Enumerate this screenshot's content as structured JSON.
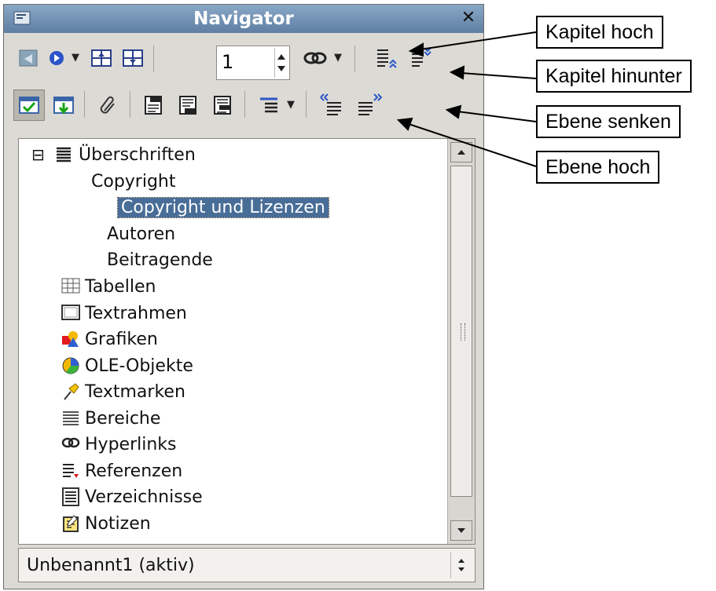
{
  "window": {
    "title": "Navigator",
    "close_glyph": "✕"
  },
  "toolbar1": {
    "spin_value": "1",
    "items": [
      {
        "icon": "toggle-icon"
      },
      {
        "icon": "navigation-icon"
      },
      {
        "icon": "previous-icon"
      },
      {
        "icon": "next-icon"
      },
      {
        "icon": "drag-mode-icon"
      },
      {
        "icon": "promote-chapter-icon"
      },
      {
        "icon": "demote-chapter-icon"
      }
    ]
  },
  "toolbar2": {
    "items": [
      {
        "icon": "content-view-icon",
        "pressed": true
      },
      {
        "icon": "set-reminder-icon"
      },
      {
        "icon": "edit-icon"
      },
      {
        "icon": "header-icon"
      },
      {
        "icon": "footer-icon"
      },
      {
        "icon": "anchor-icon"
      },
      {
        "icon": "heading-levels-icon"
      },
      {
        "icon": "promote-level-icon"
      },
      {
        "icon": "demote-level-icon"
      }
    ]
  },
  "tree": {
    "expander": "⊟",
    "items": [
      {
        "label": "Überschriften",
        "icon": "headings-icon",
        "level": 0
      },
      {
        "label": "Copyright",
        "icon": "",
        "level": 1
      },
      {
        "label": "Copyright und Lizenzen",
        "icon": "",
        "level": 2,
        "selected": true
      },
      {
        "label": "Autoren",
        "icon": "",
        "level": 3
      },
      {
        "label": "Beitragende",
        "icon": "",
        "level": 3
      },
      {
        "label": "Tabellen",
        "icon": "table-icon",
        "level": 0
      },
      {
        "label": "Textrahmen",
        "icon": "frame-icon",
        "level": 0
      },
      {
        "label": "Grafiken",
        "icon": "graphics-icon",
        "level": 0
      },
      {
        "label": "OLE-Objekte",
        "icon": "ole-icon",
        "level": 0
      },
      {
        "label": "Textmarken",
        "icon": "bookmark-icon",
        "level": 0
      },
      {
        "label": "Bereiche",
        "icon": "sections-icon",
        "level": 0
      },
      {
        "label": "Hyperlinks",
        "icon": "hyperlink-icon",
        "level": 0
      },
      {
        "label": "Referenzen",
        "icon": "references-icon",
        "level": 0
      },
      {
        "label": "Verzeichnisse",
        "icon": "indexes-icon",
        "level": 0
      },
      {
        "label": "Notizen",
        "icon": "notes-icon",
        "level": 0
      }
    ]
  },
  "document_select": {
    "value": "Unbenannt1 (aktiv)"
  },
  "callouts": [
    {
      "label": "Kapitel hoch"
    },
    {
      "label": "Kapitel hinunter"
    },
    {
      "label": "Ebene senken"
    },
    {
      "label": "Ebene hoch"
    }
  ],
  "colors": {
    "titlebar": "#6f8db0",
    "selection": "#486d97",
    "window_bg": "#dcdad5"
  }
}
